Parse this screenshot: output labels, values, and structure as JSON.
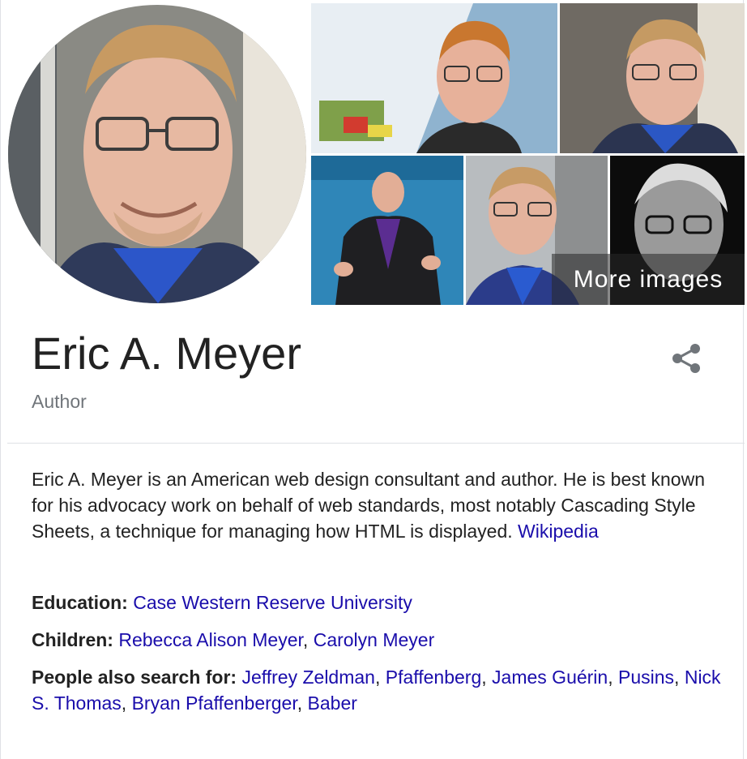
{
  "images": {
    "hero_alt": "Eric A. Meyer",
    "more_images_label": "More images"
  },
  "entity": {
    "name": "Eric A. Meyer",
    "type": "Author"
  },
  "description": {
    "text": "Eric A. Meyer is an American web design consultant and author. He is best known for his advocacy work on behalf of web standards, most notably Cascading Style Sheets, a technique for managing how HTML is displayed.",
    "source_link": "Wikipedia"
  },
  "facts": {
    "education": {
      "label": "Education:",
      "values": [
        "Case Western Reserve University"
      ]
    },
    "children": {
      "label": "Children:",
      "values": [
        "Rebecca Alison Meyer",
        "Carolyn Meyer"
      ]
    },
    "people_also_search": {
      "label": "People also search for:",
      "values": [
        "Jeffrey Zeldman",
        "Pfaffenberg",
        "James Guérin",
        "Pusins",
        "Nick S. Thomas",
        "Bryan Pfaffenberger",
        "Baber"
      ]
    }
  },
  "colors": {
    "link": "#1a0dab",
    "text": "#222222",
    "muted": "#70757a",
    "divider": "#dfe1e5"
  },
  "icons": {
    "share": "share-icon"
  }
}
